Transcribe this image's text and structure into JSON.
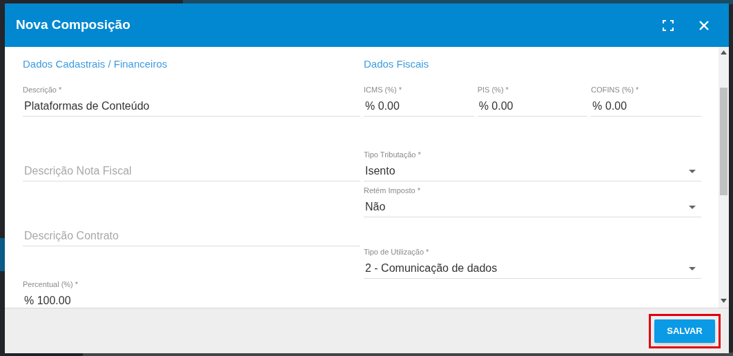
{
  "dialog": {
    "title": "Nova Composição"
  },
  "left_section": {
    "heading": "Dados Cadastrais / Financeiros",
    "fields": [
      {
        "kind": "text",
        "label": "Descrição *",
        "value": "Plataformas de Conteúdo"
      },
      {
        "kind": "text",
        "placeholder": "Descrição Nota Fiscal"
      },
      {
        "kind": "text",
        "placeholder": "Descrição Contrato"
      },
      {
        "kind": "text",
        "label": "Percentual (%) *",
        "value": "% 100.00"
      }
    ]
  },
  "right_section": {
    "heading": "Dados Fiscais",
    "rates": [
      {
        "kind": "text",
        "label": "ICMS (%) *",
        "value": "% 0.00"
      },
      {
        "kind": "text",
        "label": "PIS (%) *",
        "value": "% 0.00"
      },
      {
        "kind": "text",
        "label": "COFINS (%) *",
        "value": "% 0.00"
      }
    ],
    "fields": [
      {
        "kind": "select",
        "label": "Tipo Tributação *",
        "value": "Isento"
      },
      {
        "kind": "select",
        "label": "Retém Imposto *",
        "value": "Não"
      },
      {
        "kind": "select",
        "label": "Tipo de Utilização *",
        "value": "2 - Comunicação de dados"
      }
    ]
  },
  "footer": {
    "buttons": [
      {
        "label": "SALVAR",
        "highlighted": true
      }
    ]
  }
}
